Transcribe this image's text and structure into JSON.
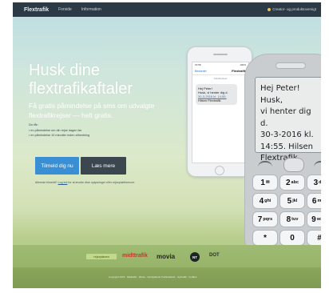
{
  "header": {
    "logo": "Flextrafik",
    "nav": [
      "Forside",
      "Information"
    ],
    "login": "Creator- og produktoversigt"
  },
  "hero": {
    "title_line1": "Husk dine",
    "title_line2": "flextrafikaftaler",
    "subtitle": "Få gratis påmindelse på sms om udvalgte flextrafikrejser — helt gratis.",
    "so_title": "Du får:",
    "bullets": [
      "en påmindelse om din rejse dagen før",
      "en påmindelse 10 minutter inden afhentning"
    ],
    "btn_primary": "Tilmeld dig nu",
    "btn_secondary": "Læs mere",
    "login_note_pre": "Allerede tilmeldt? ",
    "login_note_link": "Log ind",
    "login_note_post": " for at ændre dine oplysninger eller rejsepræferencer."
  },
  "phone1": {
    "time": "15:58",
    "battery": "100%",
    "back": "Beskeder",
    "contact": "Flextrafik",
    "date": "Tekstbesked",
    "sms_lines": [
      "Hej Peter!",
      "Husk, vi henter dig d.",
      "30-3-2016 kl. 14:55.",
      "Hilsen Flextrafik"
    ]
  },
  "phone2": {
    "sms_lines": [
      "Hej Peter! Husk,",
      "vi henter dig d.",
      "30-3-2016 kl.",
      "14:55. Hilsen",
      "Flextrafik"
    ],
    "keys": [
      {
        "main": "1",
        "sub": "✉"
      },
      {
        "main": "2",
        "sub": "abc"
      },
      {
        "main": "3",
        "sub": "def"
      },
      {
        "main": "4",
        "sub": "ghi"
      },
      {
        "main": "5",
        "sub": "jkl"
      },
      {
        "main": "6",
        "sub": "mno"
      },
      {
        "main": "7",
        "sub": "pqrs"
      },
      {
        "main": "8",
        "sub": "tuv"
      },
      {
        "main": "9",
        "sub": "wxyz"
      },
      {
        "main": "*",
        "sub": ""
      },
      {
        "main": "0",
        "sub": ""
      },
      {
        "main": "#",
        "sub": ""
      }
    ]
  },
  "partners": {
    "rejseplanen": "rejseplanen",
    "midttrafik": "midttrafik",
    "movia": "movia",
    "nt": "NT",
    "dot": "DOT"
  },
  "footer": {
    "text": "Copyright 2016 · Midttrafik · Movia · Nordjyllands Trafikselskab · Sydtrafik · FynBus"
  }
}
